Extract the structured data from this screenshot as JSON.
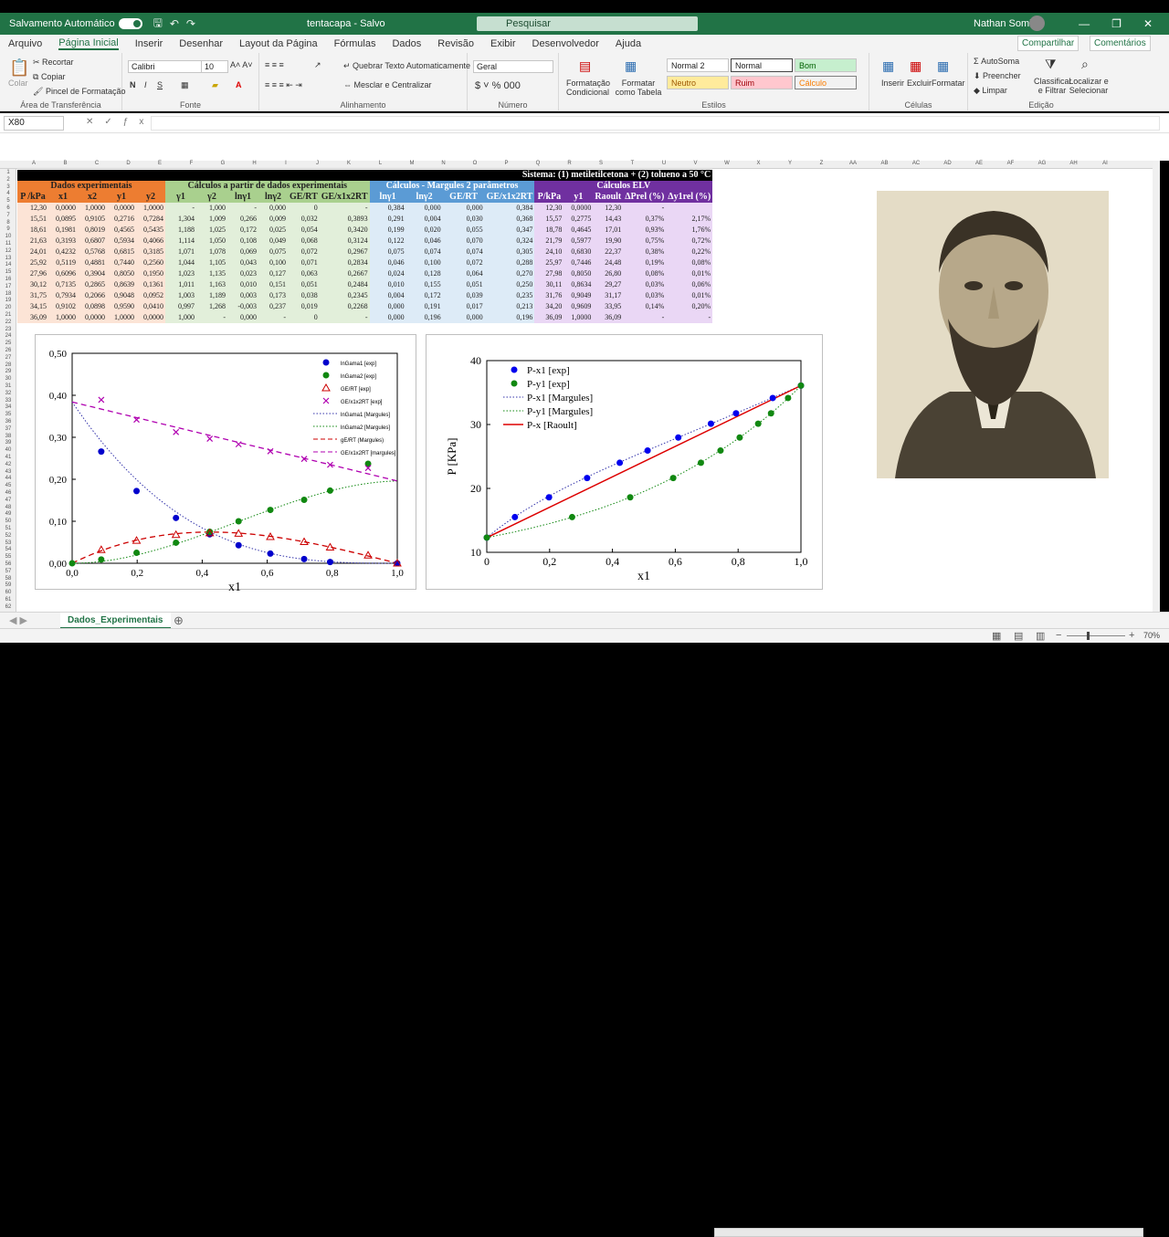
{
  "titlebar": {
    "autosave": "Salvamento Automático",
    "doc": "tentacapa - Salvo",
    "search": "Pesquisar",
    "user": "Nathan Sombra"
  },
  "menu": [
    "Arquivo",
    "Página Inicial",
    "Inserir",
    "Desenhar",
    "Layout da Página",
    "Fórmulas",
    "Dados",
    "Revisão",
    "Exibir",
    "Desenvolvedor",
    "Ajuda"
  ],
  "share": "Compartilhar",
  "comments": "Comentários",
  "ribbon": {
    "clipboard": {
      "cut": "Recortar",
      "copy": "Copiar",
      "paste": "Colar",
      "format_painter": "Pincel de Formatação",
      "label": "Área de Transferência"
    },
    "font": {
      "name": "Calibri",
      "size": "10",
      "label": "Fonte"
    },
    "align": {
      "wrap": "Quebrar Texto Automaticamente",
      "merge": "Mesclar e Centralizar",
      "label": "Alinhamento"
    },
    "number": {
      "format": "Geral",
      "label": "Número"
    },
    "styles": {
      "cond": "Formatação Condicional",
      "table": "Formatar como Tabela",
      "label": "Estilos",
      "boxes": [
        "Normal 2",
        "Normal",
        "Bom",
        "Neutro",
        "Ruim",
        "Cálculo"
      ]
    },
    "cells": {
      "insert": "Inserir",
      "delete": "Excluir",
      "format": "Formatar",
      "label": "Células"
    },
    "editing": {
      "autosum": "AutoSoma",
      "fill": "Preencher",
      "clear": "Limpar",
      "sort": "Classificar e Filtrar",
      "find": "Localizar e Selecionar",
      "label": "Edição"
    }
  },
  "namebox": "X80",
  "sheet": {
    "system": "Sistema: (1) metiletilcetona + (2) tolueno a 50 °C",
    "groups": [
      "Dados experimentais",
      "Cálculos a partir de dados experimentais",
      "Cálculos - Margules 2 parâmetros",
      "Cálculos ELV"
    ],
    "headers": [
      "P /kPa",
      "x1",
      "x2",
      "y1",
      "y2",
      "γ1",
      "γ2",
      "lnγ1",
      "lnγ2",
      "GE/RT",
      "GE/x1x2RT",
      "lnγ1",
      "lnγ2",
      "GE/RT",
      "GE/x1x2RT",
      "P/kPa",
      "y1",
      "Raoult",
      "ΔPrel (%)",
      "Δy1rel (%)"
    ],
    "rows": [
      [
        "12,30",
        "0,0000",
        "1,0000",
        "0,0000",
        "1,0000",
        "-",
        "1,000",
        "-",
        "0,000",
        "0",
        "-",
        "0,384",
        "0,000",
        "0,000",
        "0,384",
        "12,30",
        "0,0000",
        "12,30",
        "-",
        ""
      ],
      [
        "15,51",
        "0,0895",
        "0,9105",
        "0,2716",
        "0,7284",
        "1,304",
        "1,009",
        "0,266",
        "0,009",
        "0,032",
        "0,3893",
        "0,291",
        "0,004",
        "0,030",
        "0,368",
        "15,57",
        "0,2775",
        "14,43",
        "0,37%",
        "2,17%"
      ],
      [
        "18,61",
        "0,1981",
        "0,8019",
        "0,4565",
        "0,5435",
        "1,188",
        "1,025",
        "0,172",
        "0,025",
        "0,054",
        "0,3420",
        "0,199",
        "0,020",
        "0,055",
        "0,347",
        "18,78",
        "0,4645",
        "17,01",
        "0,93%",
        "1,76%"
      ],
      [
        "21,63",
        "0,3193",
        "0,6807",
        "0,5934",
        "0,4066",
        "1,114",
        "1,050",
        "0,108",
        "0,049",
        "0,068",
        "0,3124",
        "0,122",
        "0,046",
        "0,070",
        "0,324",
        "21,79",
        "0,5977",
        "19,90",
        "0,75%",
        "0,72%"
      ],
      [
        "24,01",
        "0,4232",
        "0,5768",
        "0,6815",
        "0,3185",
        "1,071",
        "1,078",
        "0,069",
        "0,075",
        "0,072",
        "0,2967",
        "0,075",
        "0,074",
        "0,074",
        "0,305",
        "24,10",
        "0,6830",
        "22,37",
        "0,38%",
        "0,22%"
      ],
      [
        "25,92",
        "0,5119",
        "0,4881",
        "0,7440",
        "0,2560",
        "1,044",
        "1,105",
        "0,043",
        "0,100",
        "0,071",
        "0,2834",
        "0,046",
        "0,100",
        "0,072",
        "0,288",
        "25,97",
        "0,7446",
        "24,48",
        "0,19%",
        "0,08%"
      ],
      [
        "27,96",
        "0,6096",
        "0,3904",
        "0,8050",
        "0,1950",
        "1,023",
        "1,135",
        "0,023",
        "0,127",
        "0,063",
        "0,2667",
        "0,024",
        "0,128",
        "0,064",
        "0,270",
        "27,98",
        "0,8050",
        "26,80",
        "0,08%",
        "0,01%"
      ],
      [
        "30,12",
        "0,7135",
        "0,2865",
        "0,8639",
        "0,1361",
        "1,011",
        "1,163",
        "0,010",
        "0,151",
        "0,051",
        "0,2484",
        "0,010",
        "0,155",
        "0,051",
        "0,250",
        "30,11",
        "0,8634",
        "29,27",
        "0,03%",
        "0,06%"
      ],
      [
        "31,75",
        "0,7934",
        "0,2066",
        "0,9048",
        "0,0952",
        "1,003",
        "1,189",
        "0,003",
        "0,173",
        "0,038",
        "0,2345",
        "0,004",
        "0,172",
        "0,039",
        "0,235",
        "31,76",
        "0,9049",
        "31,17",
        "0,03%",
        "0,01%"
      ],
      [
        "34,15",
        "0,9102",
        "0,0898",
        "0,9590",
        "0,0410",
        "0,997",
        "1,268",
        "-0,003",
        "0,237",
        "0,019",
        "0,2268",
        "0,000",
        "0,191",
        "0,017",
        "0,213",
        "34,20",
        "0,9609",
        "33,95",
        "0,14%",
        "0,20%"
      ],
      [
        "36,09",
        "1,0000",
        "0,0000",
        "1,0000",
        "0,0000",
        "1,000",
        "-",
        "0,000",
        "-",
        "0",
        "-",
        "0,000",
        "0,196",
        "0,000",
        "0,196",
        "36,09",
        "1,0000",
        "36,09",
        "-",
        "-"
      ]
    ]
  },
  "chart_data": [
    {
      "type": "scatter",
      "ylim": [
        0,
        0.5
      ],
      "xlim": [
        0,
        1
      ],
      "xlabel": "x1",
      "ylabel": "",
      "yticks": [
        "0,00",
        "0,10",
        "0,20",
        "0,30",
        "0,40",
        "0,50"
      ],
      "xticks": [
        "0,0",
        "0,2",
        "0,4",
        "0,6",
        "0,8",
        "1,0"
      ],
      "series": [
        {
          "name": "lnGama1 [exp]",
          "color": "#0000cc",
          "marker": "circle",
          "x": [
            0.0895,
            0.1981,
            0.3193,
            0.4232,
            0.5119,
            0.6096,
            0.7135,
            0.7934,
            1.0
          ],
          "y": [
            0.266,
            0.172,
            0.108,
            0.069,
            0.043,
            0.023,
            0.01,
            0.003,
            0.0
          ]
        },
        {
          "name": "lnGama2 [exp]",
          "color": "#118811",
          "marker": "circle",
          "x": [
            0,
            0.0895,
            0.1981,
            0.3193,
            0.4232,
            0.5119,
            0.6096,
            0.7135,
            0.7934,
            0.9102
          ],
          "y": [
            0,
            0.009,
            0.025,
            0.049,
            0.075,
            0.1,
            0.127,
            0.151,
            0.173,
            0.237
          ]
        },
        {
          "name": "GE/RT [exp]",
          "color": "#cc0000",
          "marker": "triangle",
          "x": [
            0.0895,
            0.1981,
            0.3193,
            0.4232,
            0.5119,
            0.6096,
            0.7135,
            0.7934,
            0.9102,
            1.0
          ],
          "y": [
            0.032,
            0.054,
            0.068,
            0.072,
            0.071,
            0.063,
            0.051,
            0.038,
            0.019,
            0.0
          ]
        },
        {
          "name": "GE/x1x2RT [exp]",
          "color": "#b000b0",
          "marker": "x",
          "x": [
            0.0895,
            0.1981,
            0.3193,
            0.4232,
            0.5119,
            0.6096,
            0.7135,
            0.7934,
            0.9102
          ],
          "y": [
            0.3893,
            0.342,
            0.3124,
            0.2967,
            0.2834,
            0.2667,
            0.2484,
            0.2345,
            0.2268
          ]
        },
        {
          "name": "lnGama1 [Margules]",
          "color": "#3333aa",
          "line": "dotted"
        },
        {
          "name": "lnGama2 [Margules]",
          "color": "#118811",
          "line": "dotted"
        },
        {
          "name": "gE/RT (Margules)",
          "color": "#cc0000",
          "line": "dashed"
        },
        {
          "name": "GE/x1x2RT [margules]",
          "color": "#b000b0",
          "line": "dashed"
        }
      ]
    },
    {
      "type": "scatter",
      "ylim": [
        10,
        40
      ],
      "xlim": [
        0,
        1
      ],
      "xlabel": "x1",
      "ylabel": "P [KPa]",
      "yticks": [
        "10",
        "20",
        "30",
        "40"
      ],
      "xticks": [
        "0",
        "0,2",
        "0,4",
        "0,6",
        "0,8",
        "1,0"
      ],
      "series": [
        {
          "name": "P-x1 [exp]",
          "color": "#0000ee",
          "marker": "circle",
          "x": [
            0,
            0.0895,
            0.1981,
            0.3193,
            0.4232,
            0.5119,
            0.6096,
            0.7135,
            0.7934,
            0.9102,
            1.0
          ],
          "y": [
            12.3,
            15.51,
            18.61,
            21.63,
            24.01,
            25.92,
            27.96,
            30.12,
            31.75,
            34.15,
            36.09
          ]
        },
        {
          "name": "P-y1 [exp]",
          "color": "#118811",
          "marker": "circle",
          "x": [
            0,
            0.2716,
            0.4565,
            0.5934,
            0.6815,
            0.744,
            0.805,
            0.8639,
            0.9048,
            0.959,
            1.0
          ],
          "y": [
            12.3,
            15.51,
            18.61,
            21.63,
            24.01,
            25.92,
            27.96,
            30.12,
            31.75,
            34.15,
            36.09
          ]
        },
        {
          "name": "P-x1 [Margules]",
          "color": "#3333aa",
          "line": "dotted"
        },
        {
          "name": "P-y1 [Margules]",
          "color": "#118811",
          "line": "dotted"
        },
        {
          "name": "P-x [Raoult]",
          "color": "#dd0000",
          "line": "solid"
        }
      ]
    }
  ],
  "tab": "Dados_Experimentais",
  "zoom": "70%"
}
